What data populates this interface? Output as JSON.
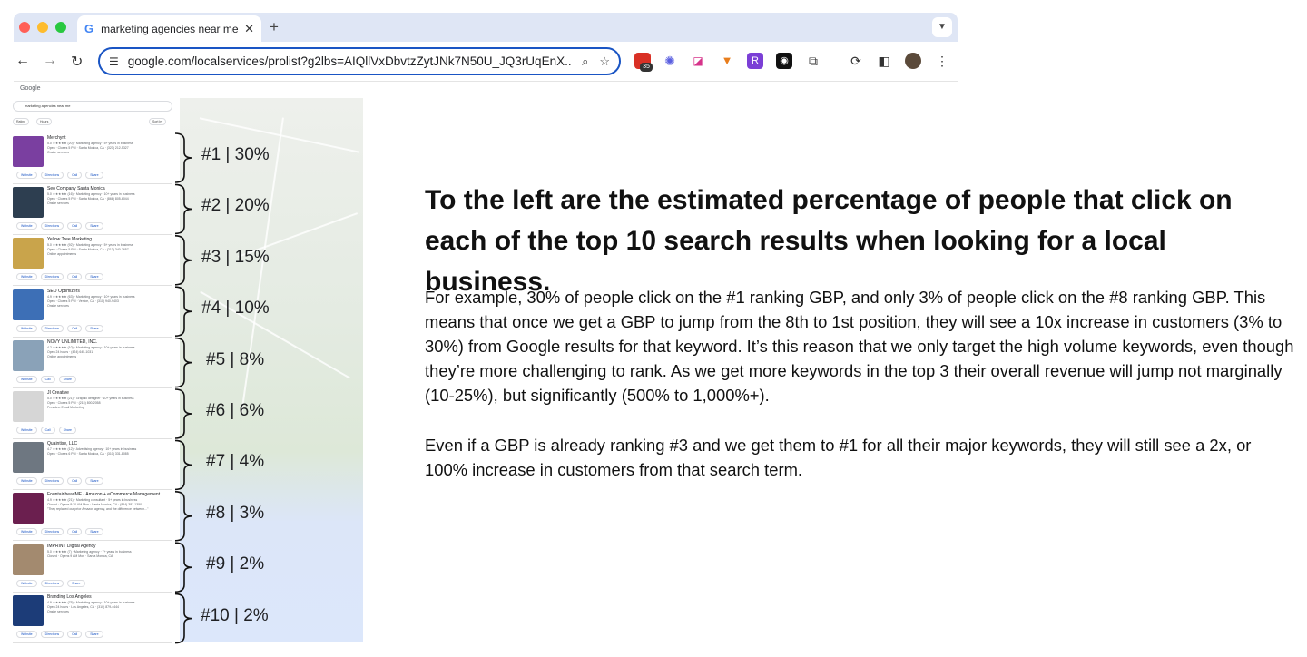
{
  "browser": {
    "tab_title": "marketing agencies near me",
    "url": "google.com/localservices/prolist?g2lbs=AIQllVxDbvtzZytJNk7N50U_JQ3rUqEnX...",
    "badge_count": "35"
  },
  "search": {
    "logo": "Google",
    "query": "marketing agencies near me",
    "filters": [
      "Rating",
      "Hours",
      "Sort by"
    ]
  },
  "listings": [
    {
      "name": "Merchynt",
      "meta": "5.0 ★★★★★ (20) · Marketing agency · 5+ years in business",
      "meta2": "Open · Closes 5 PM · Santa Monica, CA · (323) 212-5327",
      "meta3": "Onsite services",
      "buttons": [
        "Website",
        "Directions",
        "Call",
        "Share"
      ],
      "color": "#7a3fa0"
    },
    {
      "name": "Seo Company Santa Monica",
      "meta": "5.0 ★★★★★ (16) · Marketing agency · 10+ years in business",
      "meta2": "Open · Closes 5 PM · Santa Monica, CA · (866) 805-6044",
      "meta3": "Onsite services",
      "buttons": [
        "Website",
        "Directions",
        "Call",
        "Share"
      ],
      "color": "#2d3e50"
    },
    {
      "name": "Yellow Tree Marketing",
      "meta": "5.0 ★★★★★ (92) · Marketing agency · 5+ years in business",
      "meta2": "Open · Closes 5 PM · Santa Monica, CA · (213) 340-7657",
      "meta3": "Online appointments",
      "buttons": [
        "Website",
        "Directions",
        "Call",
        "Share"
      ],
      "color": "#c9a44b"
    },
    {
      "name": "SEO Optimizers",
      "meta": "4.9 ★★★★★ (63) · Marketing agency · 10+ years in business",
      "meta2": "Open · Closes 5 PM · Venice, CA · (310) 940-9403",
      "meta3": "Onsite services",
      "buttons": [
        "Website",
        "Directions",
        "Call",
        "Share"
      ],
      "color": "#3d6fb6"
    },
    {
      "name": "NOVY UNLIMITED, INC.",
      "meta": "4.2 ★★★★★ (10) · Marketing agency · 10+ years in business",
      "meta2": "Open 24 hours · (424) 645-1031",
      "meta3": "Online appointments",
      "buttons": [
        "Website",
        "Call",
        "Share"
      ],
      "color": "#8aa2b8"
    },
    {
      "name": "JI Creative",
      "meta": "5.0 ★★★★★ (21) · Graphic designer · 10+ years in business",
      "meta2": "Open · Closes 5 PM · (215) 800-2058",
      "meta3": "Provides: Email Marketing",
      "buttons": [
        "Website",
        "Call",
        "Share"
      ],
      "color": "#d6d6d6"
    },
    {
      "name": "Quaintise, LLC",
      "meta": "4.7 ★★★★★ (12) · Advertising agency · 10+ years in business",
      "meta2": "Open · Closes 6 PM · Santa Monica, CA · (310) 331-8085",
      "meta3": "",
      "buttons": [
        "Website",
        "Directions",
        "Call",
        "Share"
      ],
      "color": "#6e7781"
    },
    {
      "name": "FountainheadME - Amazon + eCommerce Management",
      "meta": "4.9 ★★★★★ (21) · Marketing consultant · 5+ years in business",
      "meta2": "Closed · Opens 8:30 AM Mon · Santa Monica, CA · (844) 381-1350",
      "meta3": "\"They replaced our prior Amazon agency, and the difference between...\"",
      "buttons": [
        "Website",
        "Directions",
        "Call",
        "Share"
      ],
      "color": "#6b1f4f"
    },
    {
      "name": "IMPRINT Digital Agency",
      "meta": "5.0 ★★★★★ (7) · Marketing agency · 7+ years in business",
      "meta2": "Closed · Opens 9 AM Mon · Santa Monica, CA",
      "meta3": "",
      "buttons": [
        "Website",
        "Directions",
        "Share"
      ],
      "color": "#a38a6f"
    },
    {
      "name": "Branding Los Angeles",
      "meta": "4.9 ★★★★★ (75) · Marketing agency · 10+ years in business",
      "meta2": "Open 24 hours · Los Angeles, CA · (310) 879-4444",
      "meta3": "Onsite services",
      "buttons": [
        "Website",
        "Directions",
        "Call",
        "Share"
      ],
      "color": "#1c3c78"
    }
  ],
  "ranks": [
    "#1 | 30%",
    "#2 | 20%",
    "#3 | 15%",
    "#4 | 10%",
    "#5 | 8%",
    "#6 | 6%",
    "#7 | 4%",
    "#8 | 3%",
    "#9 | 2%",
    "#10 | 2%"
  ],
  "headline": "To the left are the estimated percentage of people that click on each of the top 10 search results when looking for a local business.",
  "paragraph1": "For example, 30% of people click on the #1 ranking GBP, and only 3% of people click on the #8 ranking GBP. This means that once we get a GBP to jump from the 8th to 1st position, they will see a 10x increase in customers (3% to 30%) from Google results for that keyword. It’s this reason that we only target the high volume keywords, even though they’re more challenging to rank. As we get more keywords in the top 3 their overall revenue will jump not marginally (10-25%), but significantly (500% to 1,000%+).",
  "paragraph2": "Even if a GBP is already ranking #3 and we get them to #1 for all their major keywords, they will still see a 2x, or 100% increase in customers from that search term.",
  "colors": {
    "accent": "#1a55c4",
    "map_water": "#dce7fb"
  }
}
